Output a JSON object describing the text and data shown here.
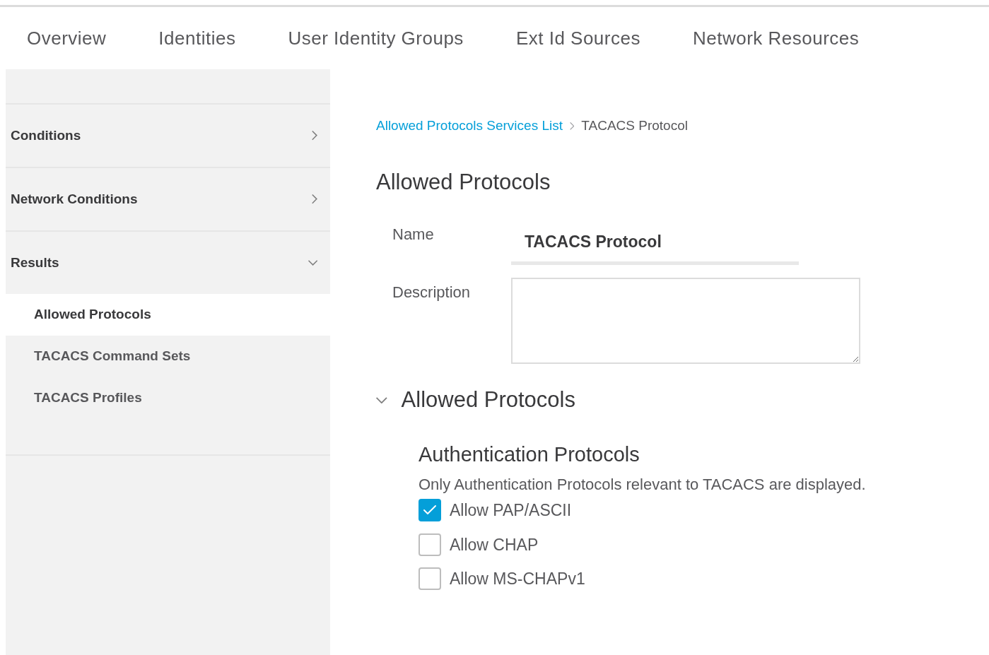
{
  "tabs": [
    {
      "label": "Overview",
      "selected": false
    },
    {
      "label": "Identities",
      "selected": false
    },
    {
      "label": "User Identity Groups",
      "selected": false
    },
    {
      "label": "Ext Id Sources",
      "selected": false
    },
    {
      "label": "Network Resources",
      "selected": false
    }
  ],
  "sidebar": {
    "sections": [
      {
        "label": "Conditions",
        "expanded": false
      },
      {
        "label": "Network Conditions",
        "expanded": false
      },
      {
        "label": "Results",
        "expanded": true,
        "children": [
          {
            "label": "Allowed Protocols",
            "selected": true
          },
          {
            "label": "TACACS Command Sets",
            "selected": false
          },
          {
            "label": "TACACS Profiles",
            "selected": false
          }
        ]
      }
    ]
  },
  "breadcrumb": {
    "link": "Allowed Protocols Services List",
    "current": "TACACS Protocol"
  },
  "title": "Allowed Protocols",
  "form": {
    "name_label": "Name",
    "name_value": "TACACS Protocol",
    "description_label": "Description"
  },
  "section": {
    "label": "Allowed Protocols",
    "expanded": true,
    "heading": "Authentication Protocols",
    "note": "Only Authentication Protocols relevant to TACACS are displayed.",
    "options": [
      {
        "label": "Allow PAP/ASCII",
        "checked": true
      },
      {
        "label": "Allow CHAP",
        "checked": false
      },
      {
        "label": "Allow MS-CHAPv1",
        "checked": false
      }
    ]
  }
}
